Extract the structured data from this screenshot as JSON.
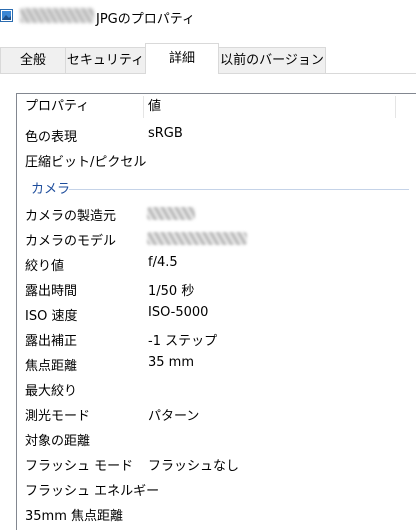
{
  "title": {
    "text": "JPGのプロパティ"
  },
  "tabs": [
    {
      "label": "全般"
    },
    {
      "label": "セキュリティ"
    },
    {
      "label": "詳細",
      "active": true
    },
    {
      "label": "以前のバージョン"
    }
  ],
  "list": {
    "columns": [
      "プロパティ",
      "値"
    ],
    "top_rows": [
      {
        "name": "色の表現",
        "value": "sRGB"
      },
      {
        "name": "圧縮ビット/ピクセル",
        "value": ""
      }
    ],
    "group": "カメラ",
    "camera_rows": [
      {
        "name": "カメラの製造元",
        "value": ""
      },
      {
        "name": "カメラのモデル",
        "value": ""
      },
      {
        "name": "絞り値",
        "value": "f/4.5"
      },
      {
        "name": "露出時間",
        "value": "1/50 秒"
      },
      {
        "name": "ISO 速度",
        "value": "ISO-5000"
      },
      {
        "name": "露出補正",
        "value": "-1 ステップ"
      },
      {
        "name": "焦点距離",
        "value": "35 mm"
      },
      {
        "name": "最大絞り",
        "value": ""
      },
      {
        "name": "測光モード",
        "value": "パターン"
      },
      {
        "name": "対象の距離",
        "value": ""
      },
      {
        "name": "フラッシュ モード",
        "value": "フラッシュなし"
      },
      {
        "name": "フラッシュ エネルギー",
        "value": ""
      },
      {
        "name": "35mm 焦点距離",
        "value": ""
      }
    ]
  },
  "icons": {
    "title_icon": "image-file-icon"
  },
  "colors": {
    "group_text": "#1e4d9c",
    "panel_border": "#828790"
  }
}
